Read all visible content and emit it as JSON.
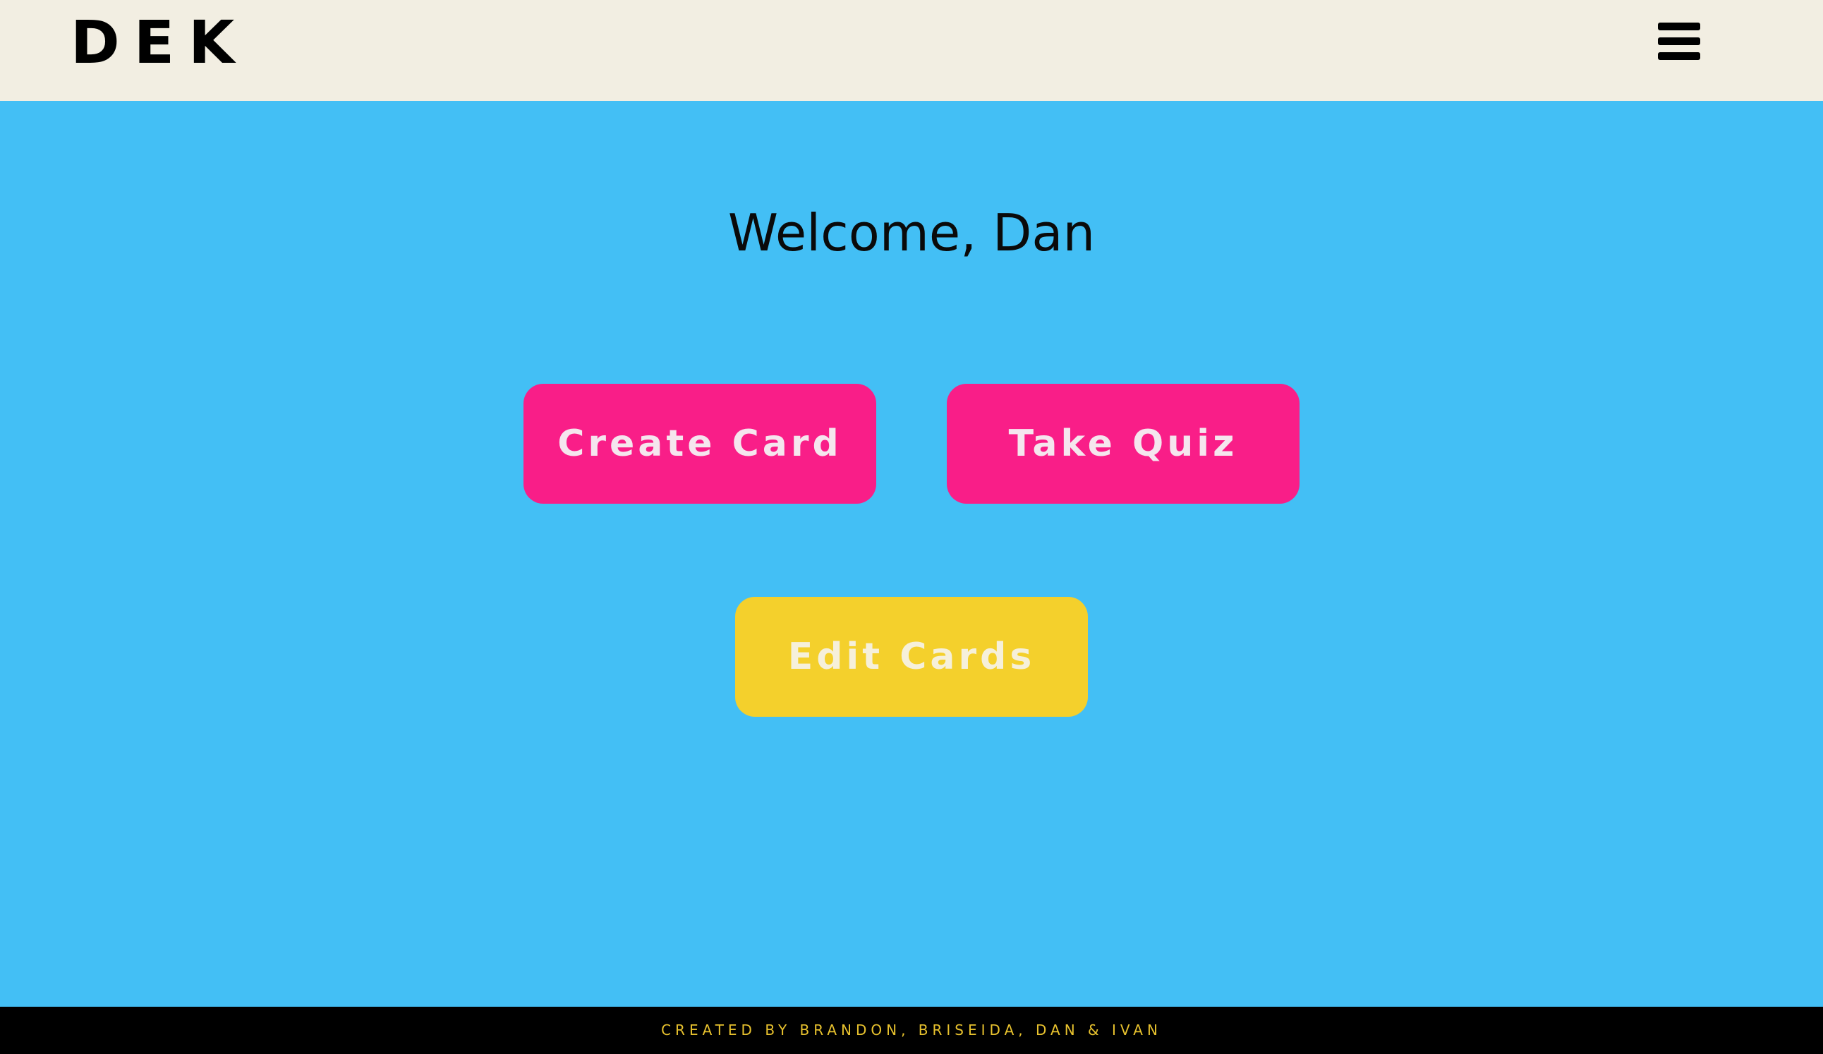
{
  "header": {
    "logo": "DEK",
    "menu_icon": "hamburger-menu-icon"
  },
  "main": {
    "welcome": "Welcome, Dan",
    "buttons": {
      "create_card": "Create Card",
      "take_quiz": "Take Quiz",
      "edit_cards": "Edit Cards"
    }
  },
  "footer": {
    "credits": "CREATED BY BRANDON, BRISEIDA, DAN & IVAN"
  },
  "colors": {
    "header_bg": "#F2EEE2",
    "page_bg": "#43BFF5",
    "primary_button": "#F91E88",
    "secondary_button": "#F4D02C",
    "footer_bg": "#000000",
    "footer_text": "#E8C22E"
  }
}
